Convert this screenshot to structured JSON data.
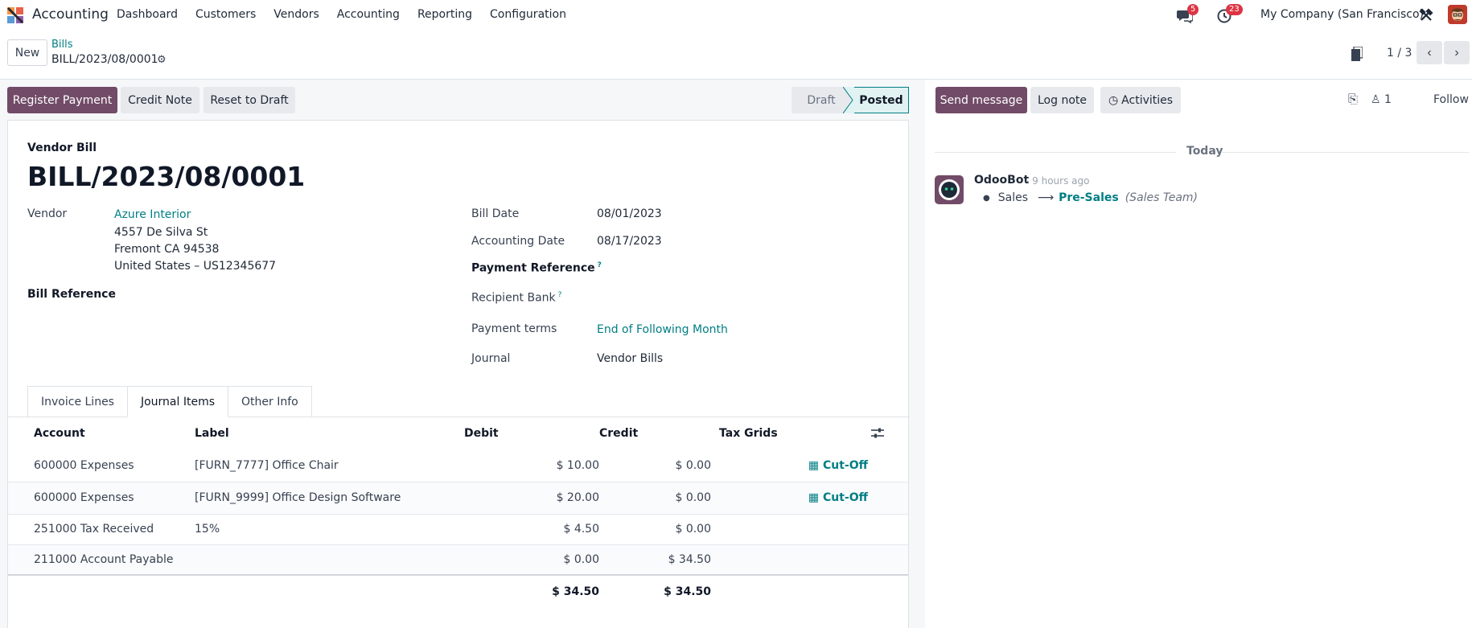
{
  "navbar": {
    "app_name": "Accounting",
    "menu": [
      "Dashboard",
      "Customers",
      "Vendors",
      "Accounting",
      "Reporting",
      "Configuration"
    ],
    "messages_count": "5",
    "activities_count": "23",
    "company": "My Company (San Francisco)"
  },
  "control_panel": {
    "new_label": "New",
    "breadcrumb_parent": "Bills",
    "breadcrumb_current": "BILL/2023/08/0001",
    "pager_value": "1 / 3"
  },
  "actions": {
    "register_payment": "Register Payment",
    "credit_note": "Credit Note",
    "reset_to_draft": "Reset to Draft"
  },
  "status": {
    "draft": "Draft",
    "posted": "Posted",
    "current": "Posted"
  },
  "chatter_actions": {
    "send_message": "Send message",
    "log_note": "Log note",
    "activities": "Activities",
    "followers_count": "1",
    "follow": "Follow"
  },
  "form": {
    "doc_type": "Vendor Bill",
    "name": "BILL/2023/08/0001",
    "vendor_label": "Vendor",
    "vendor_name": "Azure Interior",
    "vendor_address": [
      "4557 De Silva St",
      "Fremont CA 94538",
      "United States – US12345677"
    ],
    "bill_reference_label": "Bill Reference",
    "bill_date_label": "Bill Date",
    "bill_date": "08/01/2023",
    "accounting_date_label": "Accounting Date",
    "accounting_date": "08/17/2023",
    "payment_reference_label": "Payment Reference",
    "recipient_bank_label": "Recipient Bank",
    "payment_terms_label": "Payment terms",
    "payment_terms": "End of Following Month",
    "journal_label": "Journal",
    "journal": "Vendor Bills",
    "help_mark": "?"
  },
  "tabs": [
    "Invoice Lines",
    "Journal Items",
    "Other Info"
  ],
  "active_tab": "Journal Items",
  "journal_items": {
    "headers": [
      "Account",
      "Label",
      "Debit",
      "Credit",
      "Tax Grids"
    ],
    "rows": [
      {
        "account": "600000 Expenses",
        "label": "[FURN_7777] Office Chair",
        "debit": "$ 10.00",
        "credit": "$ 0.00",
        "action": "Cut-Off"
      },
      {
        "account": "600000 Expenses",
        "label": "[FURN_9999] Office Design Software",
        "debit": "$ 20.00",
        "credit": "$ 0.00",
        "action": "Cut-Off"
      },
      {
        "account": "251000 Tax Received",
        "label": "15%",
        "debit": "$ 4.50",
        "credit": "$ 0.00",
        "action": ""
      },
      {
        "account": "211000 Account Payable",
        "label": "",
        "debit": "$ 0.00",
        "credit": "$ 34.50",
        "action": ""
      }
    ],
    "total_debit": "$ 34.50",
    "total_credit": "$ 34.50"
  },
  "chatter": {
    "date_separator": "Today",
    "author": "OdooBot",
    "time": "- 9 hours ago",
    "tracking_old": "Sales",
    "tracking_new": "Pre-Sales",
    "tracking_field": "(Sales Team)"
  },
  "colors": {
    "brand": "#714b67",
    "link": "#017e84",
    "badge": "#dc3545"
  }
}
